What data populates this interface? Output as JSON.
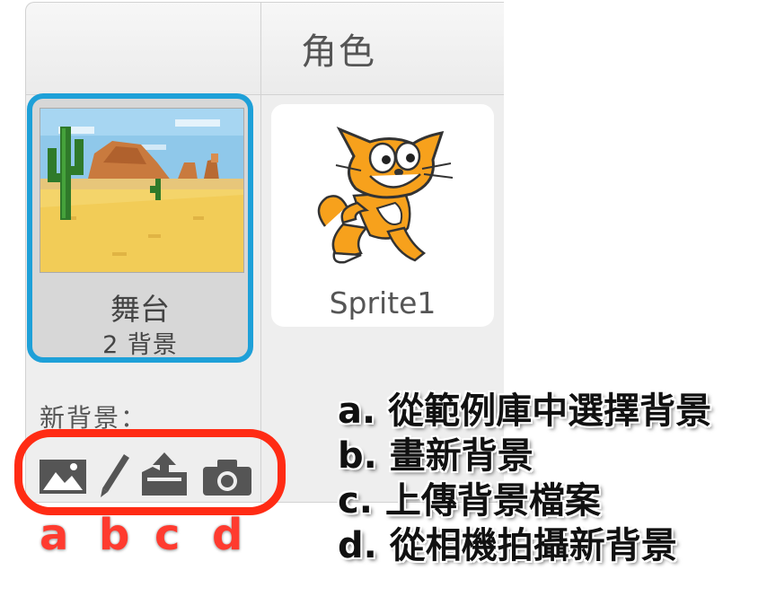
{
  "sprites_panel": {
    "heading": "角色"
  },
  "stage": {
    "name": "舞台",
    "backdrop_count": "2 背景",
    "thumbnail": "desert-backdrop"
  },
  "sprite": {
    "name": "Sprite1",
    "image": "scratch-cat"
  },
  "new_backdrop": {
    "label": "新背景：",
    "tools": [
      {
        "icon": "landscape-icon",
        "letter": "a"
      },
      {
        "icon": "paintbrush-icon",
        "letter": "b"
      },
      {
        "icon": "upload-icon",
        "letter": "c"
      },
      {
        "icon": "camera-icon",
        "letter": "d"
      }
    ]
  },
  "legend": [
    "a. 從範例庫中選擇背景",
    "b. 畫新背景",
    "c. 上傳背景檔案",
    "d. 從相機拍攝新背景"
  ],
  "colors": {
    "selected_border": "#1ea0d8",
    "highlight": "#ff2b14",
    "tab_letters": "#ff3b2f",
    "cat_orange": "#f7a11c"
  }
}
